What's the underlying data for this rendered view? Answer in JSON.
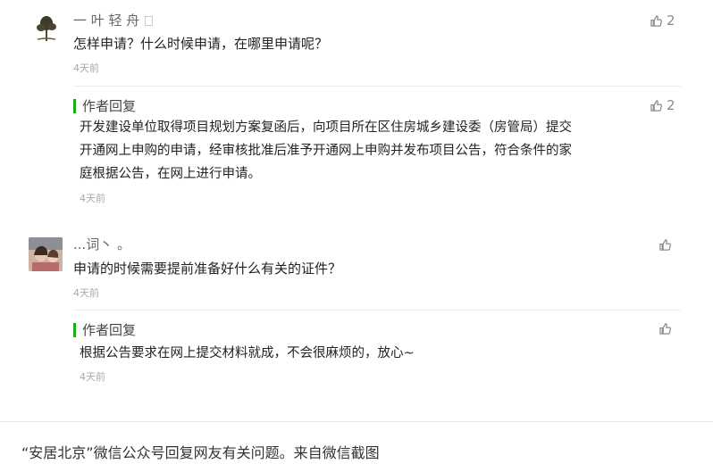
{
  "comments": [
    {
      "author": "一 叶 轻 舟",
      "text": "怎样申请？什么时候申请，在哪里申请呢？",
      "time": "4天前",
      "likes": "2",
      "reply": {
        "label": "作者回复",
        "lines": [
          "开发建设单位取得项目规划方案复函后，向项目所在区住房城乡建设委（房管局）提交",
          "开通网上申购的申请，经审核批准后准予开通网上申购并发布项目公告，符合条件的家",
          "庭根据公告，在网上进行申请。"
        ],
        "time": "4天前",
        "likes": "2"
      }
    },
    {
      "author": "...词丶 。",
      "text": "申请的时候需要提前准备好什么有关的证件？",
      "time": "4天前",
      "likes": "",
      "reply": {
        "label": "作者回复",
        "lines": [
          "根据公告要求在网上提交材料就成，不会很麻烦的，放心~"
        ],
        "time": "4天前",
        "likes": ""
      }
    }
  ],
  "caption": "“安居北京”微信公众号回复网友有关问题。来自微信截图",
  "colors": {
    "reply_bar": "#1aad19",
    "time": "#aaaaaa",
    "like": "#8a8a8a"
  },
  "icons": [
    "thumbs-up-icon",
    "avatar-tree-icon",
    "avatar-photo"
  ]
}
